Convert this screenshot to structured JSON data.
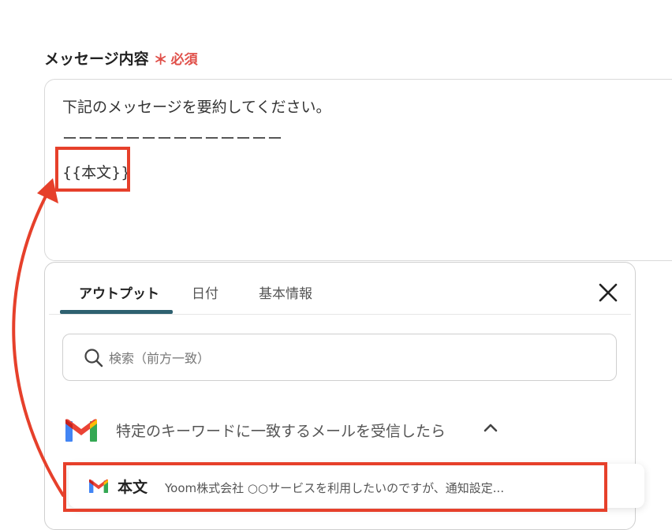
{
  "field": {
    "label": "メッセージ内容",
    "required_star": "＊",
    "required_text": "必須"
  },
  "textarea": {
    "line1": "下記のメッセージを要約してください。",
    "line2": "ーーーーーーーーーーーーーー",
    "line3": "{{本文}}"
  },
  "panel": {
    "tabs": [
      "アウトプット",
      "日付",
      "基本情報"
    ],
    "active_tab": "アウトプット",
    "search": {
      "placeholder": "検索（前方一致）",
      "value": ""
    },
    "section_title": "特定のキーワードに一致するメールを受信したら",
    "item": {
      "key": "本文",
      "value": "Yoom株式会社 ○○サービスを利用したいのですが、通知設定..."
    }
  },
  "colors": {
    "highlight": "#e6402b",
    "tab_underline": "#2e6170",
    "required": "#e0504a"
  }
}
